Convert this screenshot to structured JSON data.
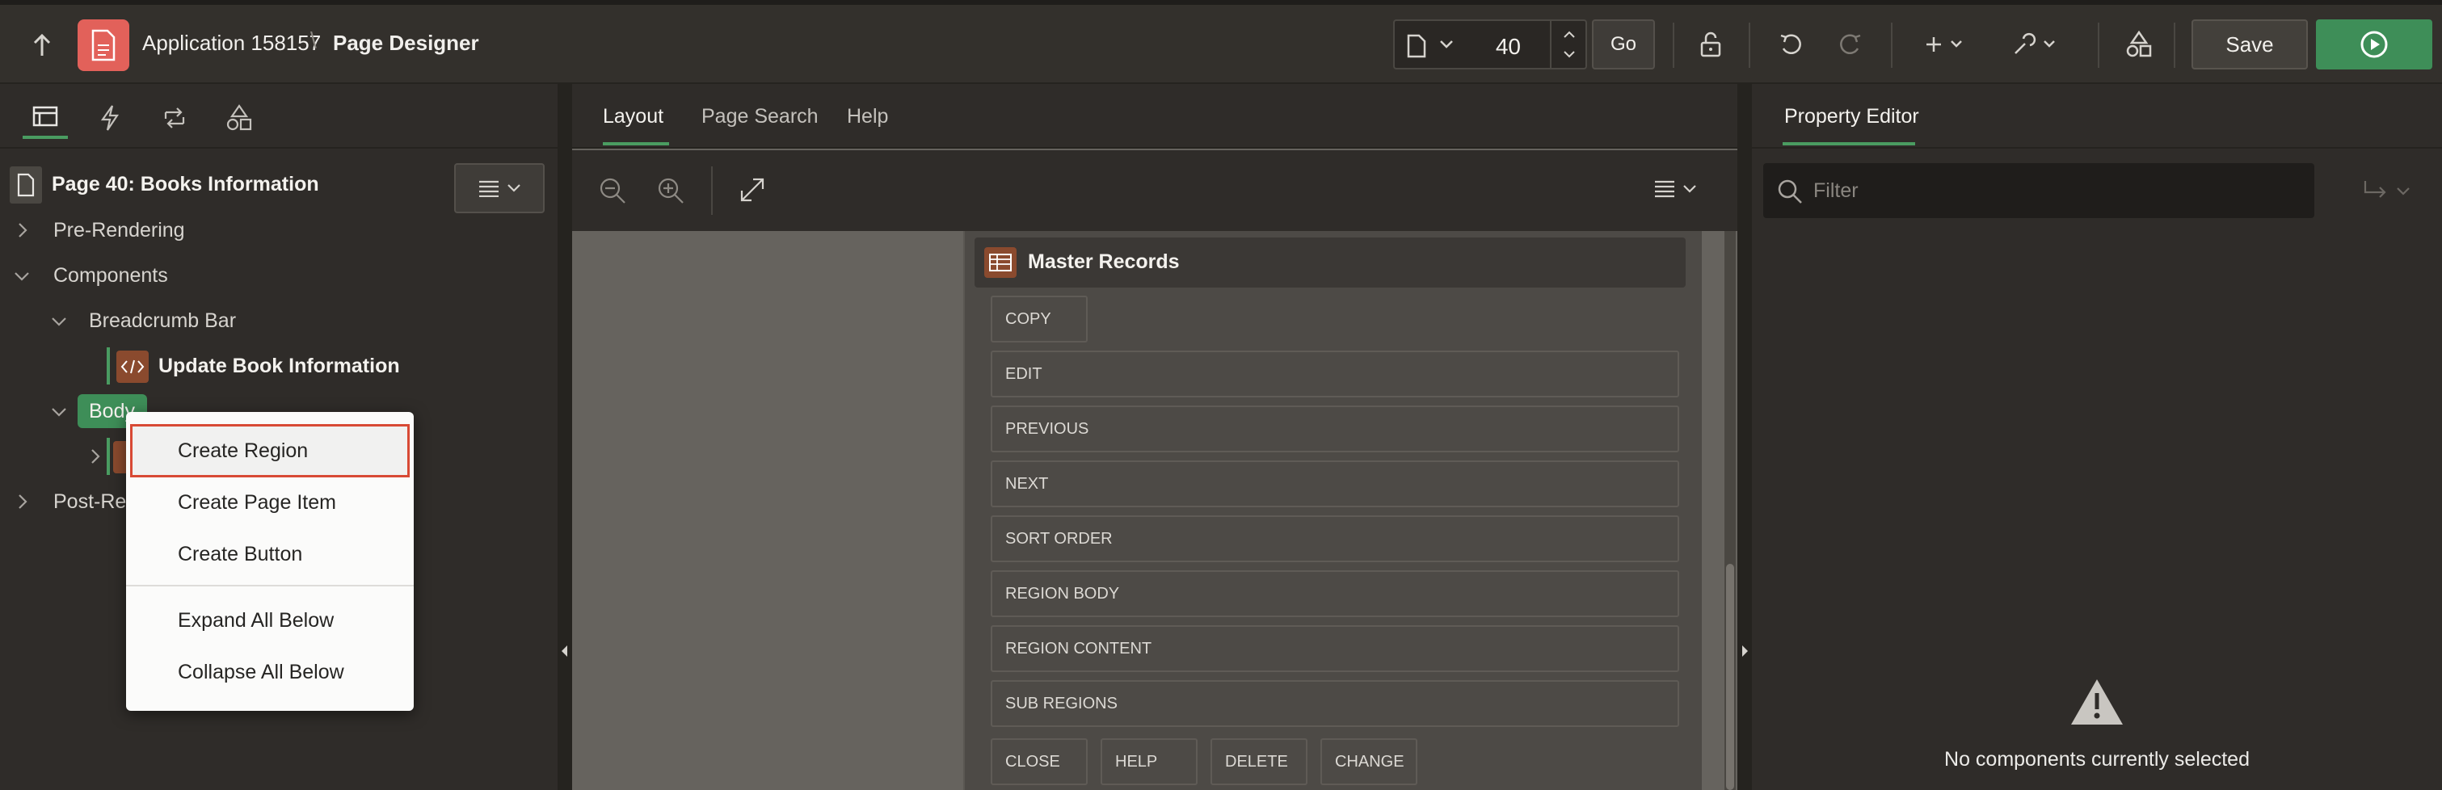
{
  "header": {
    "app_title": "Application 158157",
    "separator": "\\",
    "page_designer": "Page Designer",
    "page_number": "40",
    "go_label": "Go",
    "save_label": "Save"
  },
  "left": {
    "tree": {
      "root": "Page 40: Books Information",
      "pre_rendering": "Pre-Rendering",
      "components": "Components",
      "breadcrumb_bar": "Breadcrumb Bar",
      "update_book": "Update Book Information",
      "body": "Body",
      "post_rendering": "Post-Re"
    },
    "context_menu": [
      "Create Region",
      "Create Page Item",
      "Create Button",
      "Expand All Below",
      "Collapse All Below"
    ]
  },
  "center": {
    "tabs": [
      "Layout",
      "Page Search",
      "Help"
    ],
    "region_title": "Master Records",
    "slots": [
      "COPY",
      "EDIT",
      "PREVIOUS",
      "NEXT",
      "SORT ORDER",
      "REGION BODY",
      "REGION CONTENT",
      "SUB REGIONS"
    ],
    "bottom_slots": [
      "CLOSE",
      "HELP",
      "DELETE",
      "CHANGE"
    ]
  },
  "right": {
    "tab": "Property Editor",
    "filter_placeholder": "Filter",
    "empty_message": "No components currently selected"
  },
  "colors": {
    "accent_green": "#4a9c61",
    "run_green": "#3e8e58",
    "app_icon_red": "#e2615a",
    "selection_outline": "#d84a35"
  }
}
